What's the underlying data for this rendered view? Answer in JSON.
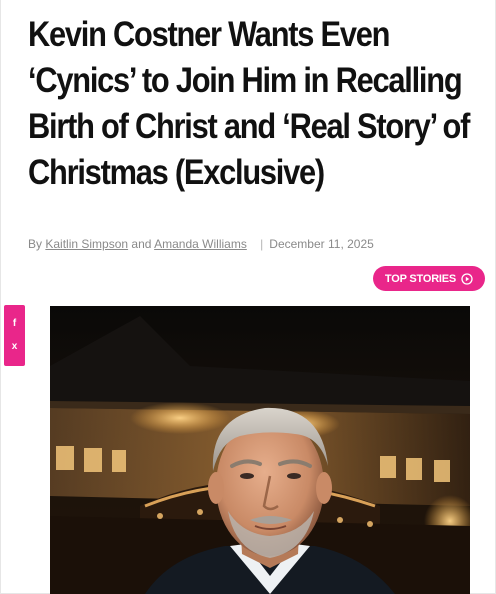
{
  "article": {
    "headline": "Kevin Costner Wants Even ‘Cynics’ to Join Him in Recalling Birth of Christ and ‘Real Story’ of Christmas (Exclusive)",
    "byline": {
      "prefix": "By",
      "author_1": "Kaitlin Simpson",
      "conjunction": "and",
      "author_2": "Amanda Williams",
      "separator": "|",
      "date": "December 11, 2025"
    }
  },
  "top_stories_button": {
    "label": "TOP STORIES",
    "icon": "play-circle-icon",
    "color": "#e9268a"
  },
  "share_rail": {
    "color": "#e9268a",
    "items": [
      {
        "icon": "facebook-icon",
        "glyph": "f"
      },
      {
        "icon": "x-icon",
        "glyph": "x"
      }
    ]
  }
}
